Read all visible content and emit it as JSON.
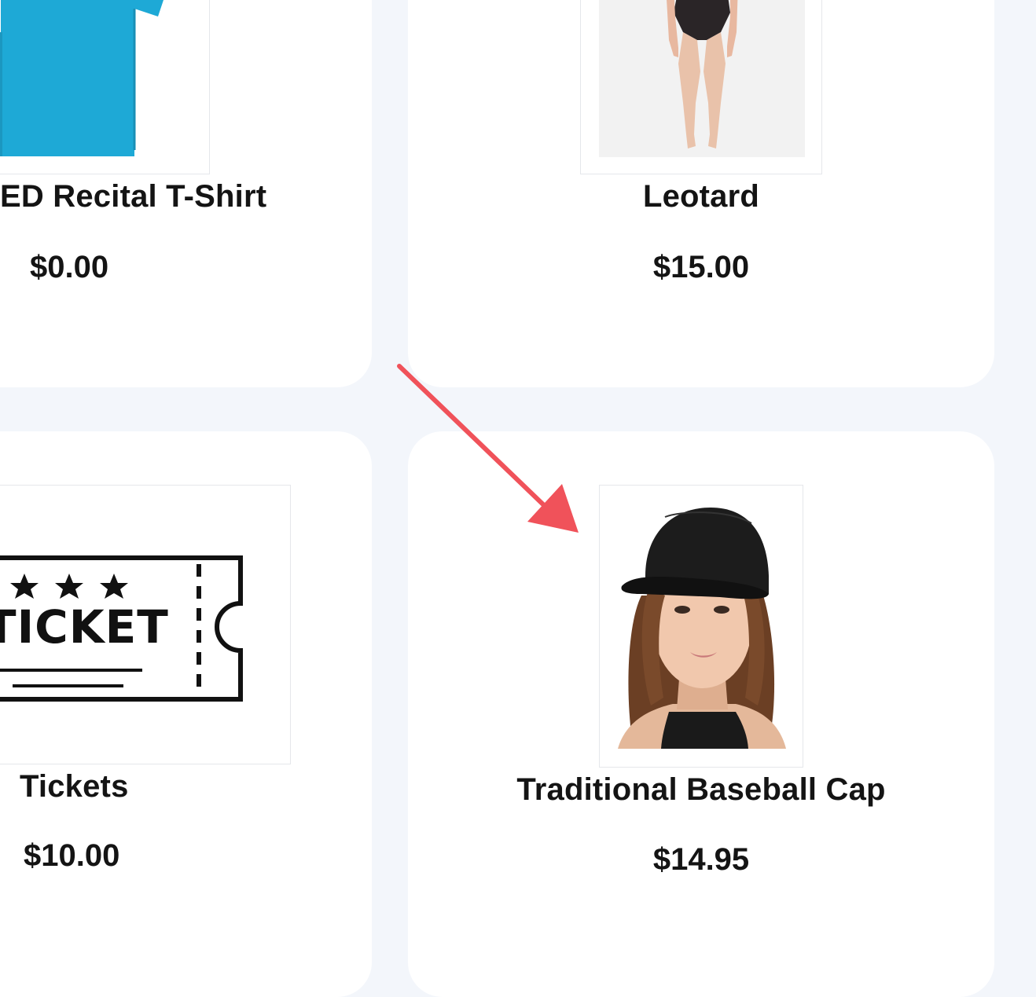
{
  "products": [
    {
      "name": "ED Recital T-Shirt",
      "price": "$0.00",
      "image": "blue-tshirt-image"
    },
    {
      "name": "Leotard",
      "price": "$15.00",
      "image": "leotard-image"
    },
    {
      "name": "Tickets",
      "price": "$10.00",
      "image": "ticket-image",
      "image_text": "TICKET"
    },
    {
      "name": "Traditional Baseball Cap",
      "price": "$14.95",
      "image": "baseball-cap-image"
    }
  ],
  "annotation": {
    "icon": "arrow-icon",
    "color": "#f0525a"
  },
  "colors": {
    "background": "#f3f6fb",
    "card": "#ffffff",
    "text": "#141414"
  }
}
